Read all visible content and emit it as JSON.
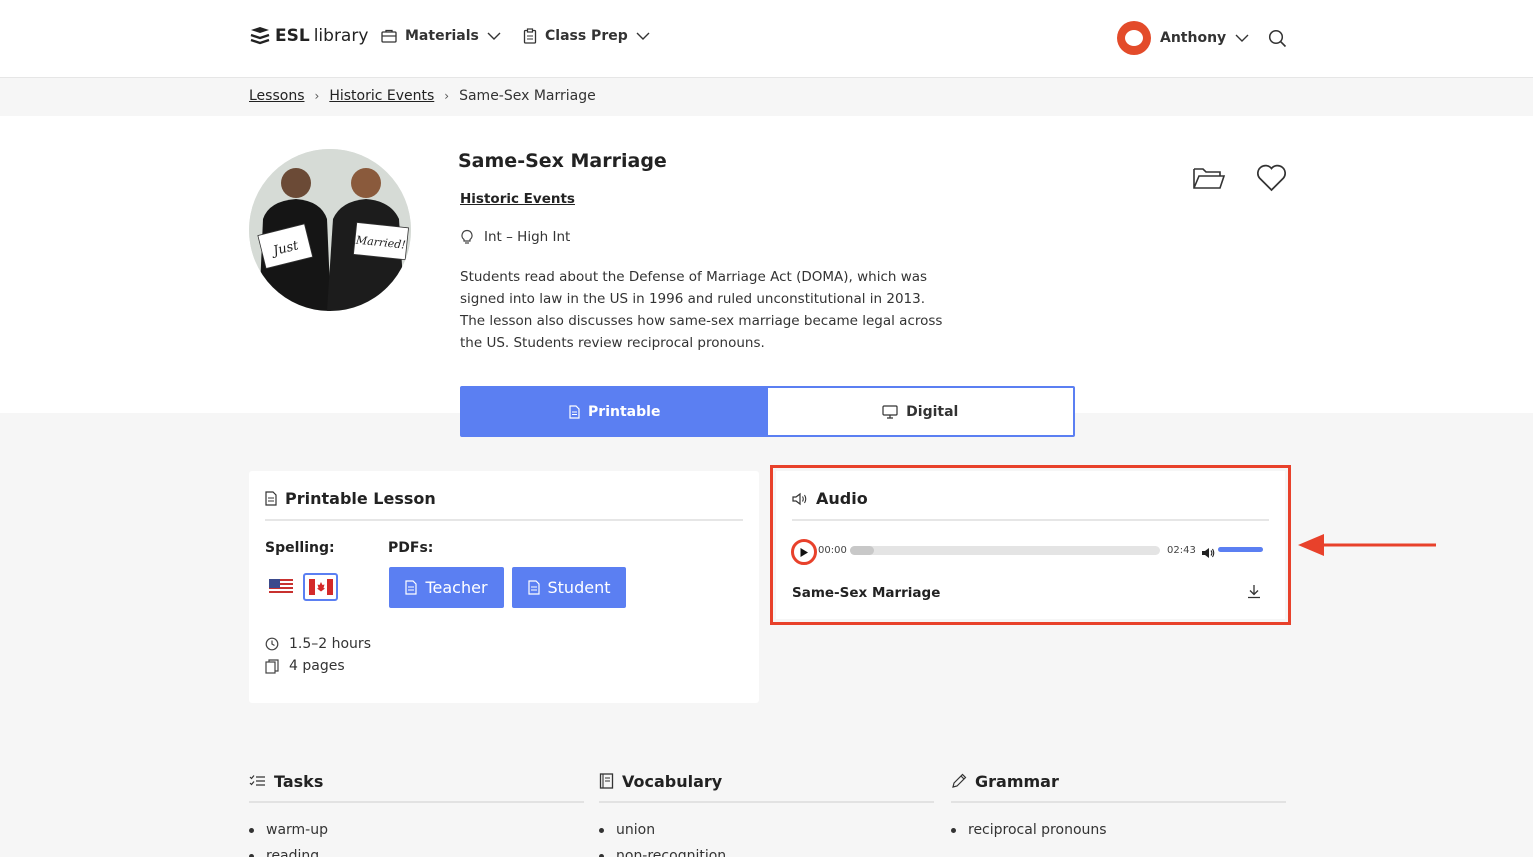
{
  "header": {
    "logo_brand": "ESL",
    "logo_suffix": "library",
    "nav": [
      {
        "label": "Materials",
        "icon": "briefcase-icon"
      },
      {
        "label": "Class Prep",
        "icon": "clipboard-icon"
      }
    ],
    "user_name": "Anthony"
  },
  "breadcrumb": [
    "Lessons",
    "Historic Events",
    "Same-Sex Marriage"
  ],
  "lesson": {
    "title": "Same-Sex Marriage",
    "category": "Historic Events",
    "level": "Int – High Int",
    "description": "Students read about the Defense of Marriage Act (DOMA), which was signed into law in the US in 1996 and ruled unconstitutional in 2013. The lesson also discusses how same-sex marriage became legal across the US. Students review reciprocal pronouns.",
    "image_sign_left": "Just",
    "image_sign_right": "Married!"
  },
  "toggle": {
    "printable": "Printable",
    "digital": "Digital",
    "active": "Printable"
  },
  "printable_card": {
    "title": "Printable Lesson",
    "spelling_label": "Spelling:",
    "pdfs_label": "PDFs:",
    "teacher_button": "Teacher",
    "student_button": "Student",
    "duration": "1.5–2 hours",
    "pages": "4 pages"
  },
  "audio_card": {
    "title": "Audio",
    "current_time": "00:00",
    "total_time": "02:43",
    "progress": 0.0,
    "volume": 1.0,
    "track_title": "Same-Sex Marriage"
  },
  "columns": [
    {
      "title": "Tasks",
      "icon": "checklist-icon",
      "items": [
        "warm-up",
        "reading"
      ]
    },
    {
      "title": "Vocabulary",
      "icon": "book-icon",
      "items": [
        "union",
        "non-recognition"
      ]
    },
    {
      "title": "Grammar",
      "icon": "pencil-icon",
      "items": [
        "reciprocal pronouns"
      ]
    }
  ],
  "colors": {
    "accent": "#5b7ff2",
    "highlight": "#e8412b"
  }
}
